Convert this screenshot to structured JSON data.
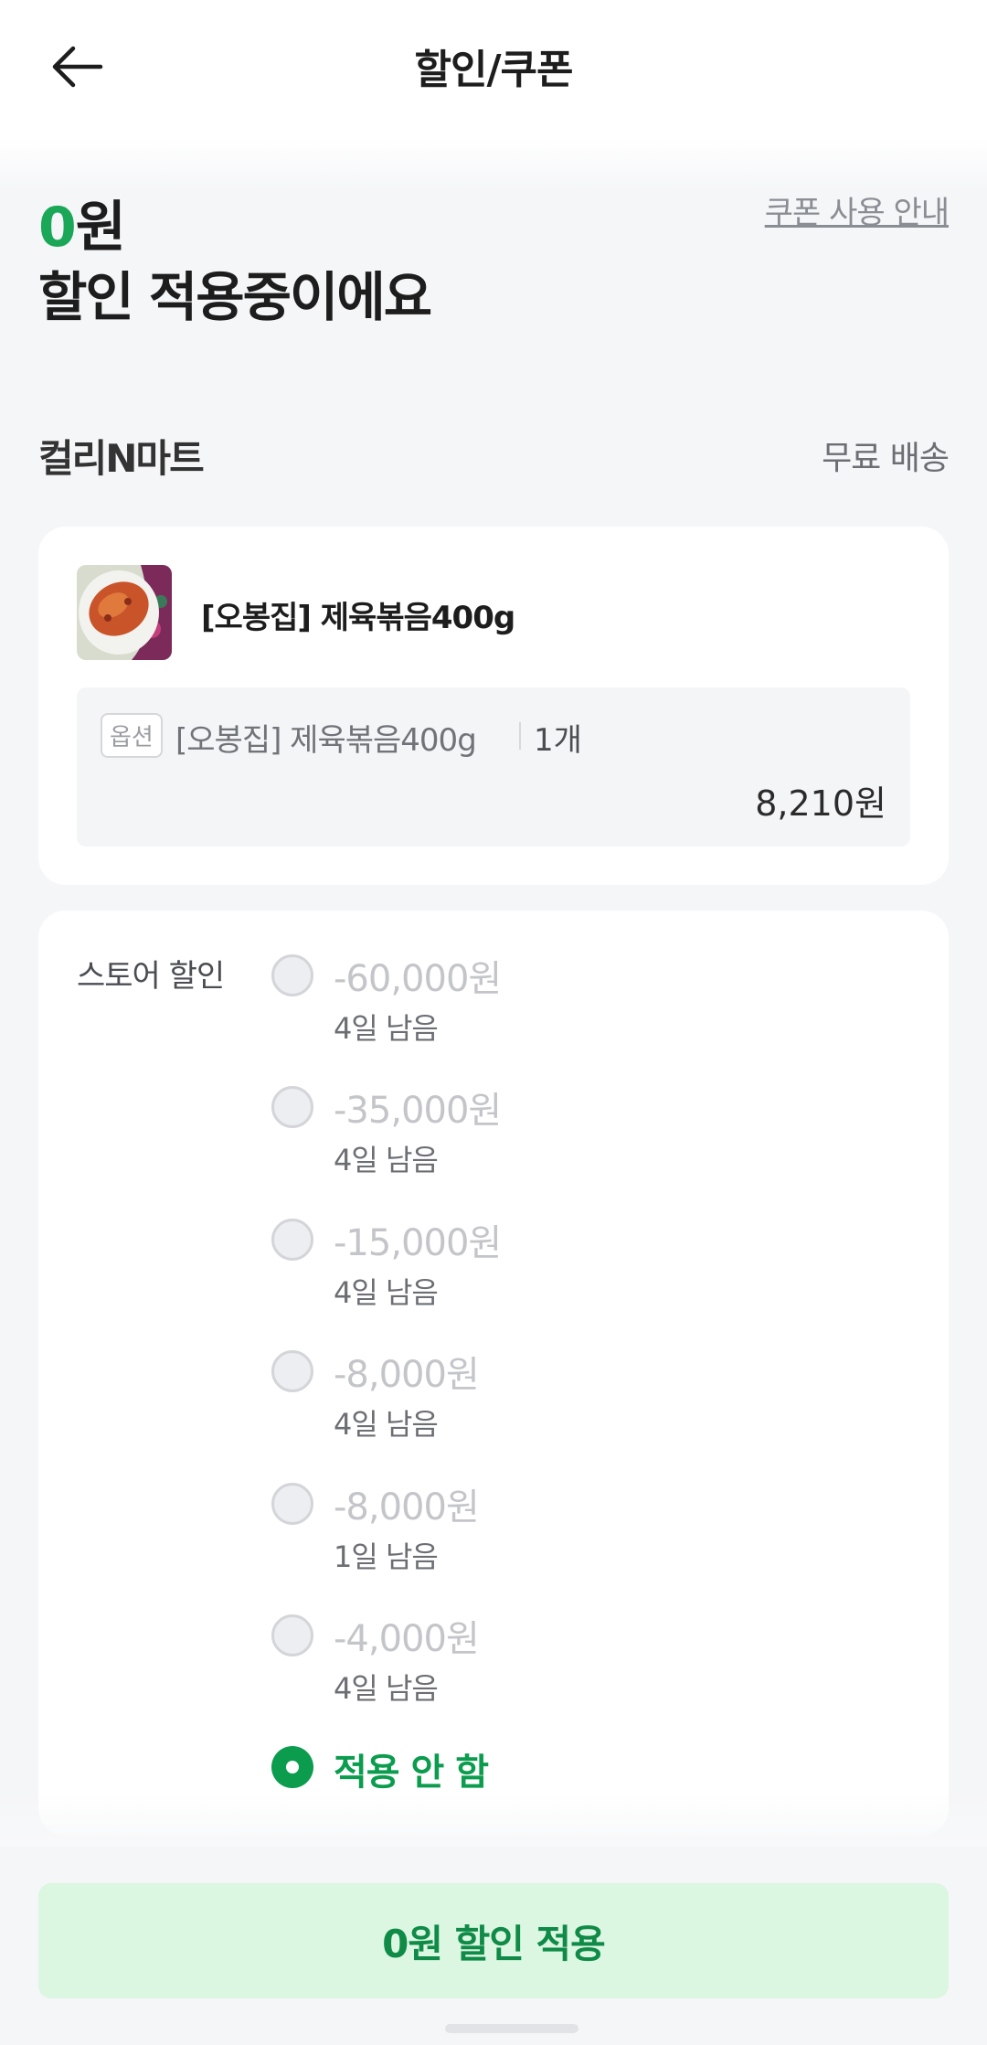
{
  "header": {
    "title": "할인/쿠폰",
    "back_icon": "arrow-left-icon"
  },
  "summary": {
    "amount_number": "0",
    "amount_unit": "원",
    "text": "할인 적용중이에요",
    "accent_color": "#1aa758"
  },
  "guide_link": "쿠폰 사용 안내",
  "store": {
    "name": "컬리N마트",
    "shipping": "무료 배송"
  },
  "product": {
    "name": "[오봉집] 제육볶음400g",
    "thumb_icon": "food-thumbnail-image",
    "option": {
      "tag": "옵션",
      "name": "[오봉집] 제육볶음400g",
      "quantity": "1개",
      "price": "8,210원"
    }
  },
  "coupons": {
    "label": "스토어 할인",
    "items": [
      {
        "amount": "-60,000원",
        "expiry": "4일 남음",
        "selected": false
      },
      {
        "amount": "-35,000원",
        "expiry": "4일 남음",
        "selected": false
      },
      {
        "amount": "-15,000원",
        "expiry": "4일 남음",
        "selected": false
      },
      {
        "amount": "-8,000원",
        "expiry": "4일 남음",
        "selected": false
      },
      {
        "amount": "-8,000원",
        "expiry": "1일 남음",
        "selected": false
      },
      {
        "amount": "-4,000원",
        "expiry": "4일 남음",
        "selected": false
      }
    ],
    "none_label": "적용 안 함",
    "none_selected": true
  },
  "apply_button": "0원 할인 적용",
  "colors": {
    "primary_green": "#0b9c4e",
    "button_bg": "#dbf6e1"
  }
}
